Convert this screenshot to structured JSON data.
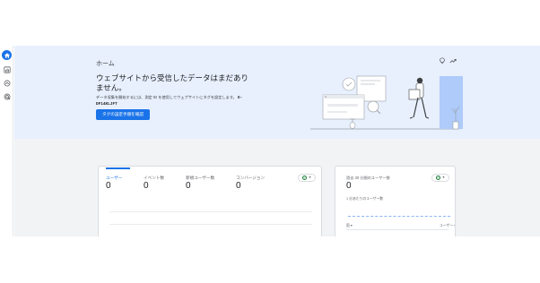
{
  "nav": {
    "items": [
      {
        "name": "home",
        "icon": "home-icon",
        "active": true
      },
      {
        "name": "reports",
        "icon": "bar-chart-icon",
        "active": false
      },
      {
        "name": "explore",
        "icon": "explore-icon",
        "active": false
      },
      {
        "name": "advertising",
        "icon": "target-icon",
        "active": false
      }
    ]
  },
  "hero": {
    "title": "ホーム",
    "heading": "ウェブサイトから受信したデータはまだありません。",
    "description": "データ収集を開始するには、測定 ID を使用してウェブサイトにタグを設定します。",
    "measurement_id": "G-DF14KLJFT",
    "button_label": "タグの設定手順を確認",
    "insight_icon": "lightbulb-icon",
    "trend_icon": "trending-icon"
  },
  "metrics": {
    "tabs": [
      {
        "label": "ユーザー",
        "value": "0",
        "active": true
      },
      {
        "label": "イベント数",
        "value": "0",
        "active": false
      },
      {
        "label": "新規ユーザー数",
        "value": "0",
        "active": false
      },
      {
        "label": "コンバージョン",
        "value": "0",
        "active": false
      }
    ]
  },
  "realtime": {
    "title": "過去 30 分間のユーザー数",
    "value": "0",
    "subtitle": "1 分あたりのユーザー数",
    "country_label": "国",
    "dimension_label": "ユーザー"
  },
  "colors": {
    "accent": "#1a73e8",
    "hero_bg": "#e8f0fe",
    "page_bg": "#f1f3f4",
    "success": "#188038"
  }
}
